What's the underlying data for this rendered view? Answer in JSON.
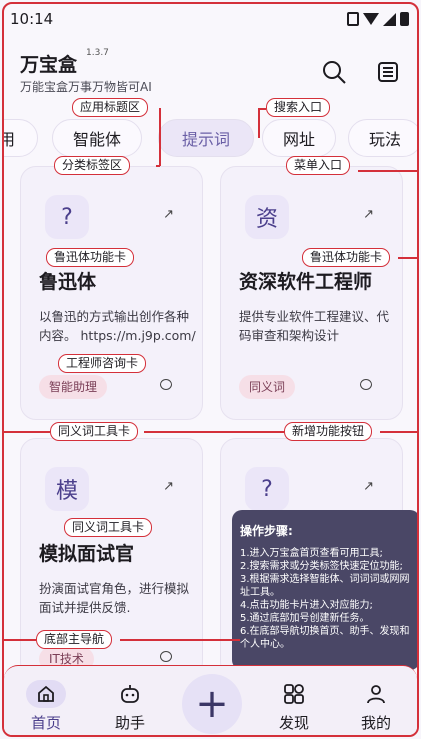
{
  "status": {
    "time": "10:14"
  },
  "header": {
    "title": "万宝盒",
    "version": "1.3.7",
    "subtitle": "万能宝盒万事万物皆可AI"
  },
  "tabs": [
    {
      "label": "用",
      "active": false
    },
    {
      "label": "智能体",
      "active": false
    },
    {
      "label": "提示词",
      "active": true
    },
    {
      "label": "网址",
      "active": false
    },
    {
      "label": "玩法",
      "active": false
    }
  ],
  "cards": [
    {
      "icon": "question-icon",
      "glyph": "?",
      "name": "鲁迅体",
      "desc": "以鲁迅的方式输出创作各种内容。",
      "url": "https://m.j9p.com/",
      "chip": "智能助理"
    },
    {
      "icon": "hexagon-zi-icon",
      "glyph": "资",
      "name": "资深软件工程师",
      "desc": "提供专业软件工程建议、代码审查和架构设计",
      "chip": "同义词"
    },
    {
      "icon": "mo-square-icon",
      "glyph": "模",
      "name": "模拟面试官",
      "desc": "扮演面试官角色，进行模拟面试并提供反馈.",
      "chip": "IT技术"
    },
    {
      "icon": "question-icon",
      "glyph": "?"
    }
  ],
  "tooltip": {
    "title": "操作步骤:",
    "steps": [
      "1.进入万宝盒首页查看可用工具;",
      "2.搜索需求或分类标签快速定位功能;",
      "3.根据需求选择智能体、词词词或网网址工具。",
      "4.点击功能卡片进入对应能力;",
      "5.通过底部加号创建新任务。",
      "6.在底部导航切换首页、助手、发现和个人中心。"
    ]
  },
  "annotations": {
    "app_title_area": "应用标题区",
    "search_entry": "搜索入口",
    "category_tabs": "分类标签区",
    "menu_entry": "菜单入口",
    "luxun_card_1": "鲁迅体功能卡",
    "luxun_card_2": "鲁迅体功能卡",
    "engineer_card": "工程师咨询卡",
    "synonym_tool": "同义词工具卡",
    "add_button": "新增功能按钮",
    "synonym_tool_2": "同义词工具卡",
    "bottom_nav": "底部主导航"
  },
  "nav": {
    "home": "首页",
    "assistant": "助手",
    "discover": "发现",
    "mine": "我的"
  },
  "colors": {
    "accent": "#6a5fa6",
    "annotation": "#d4303a",
    "chip": "#f6dfe7"
  }
}
